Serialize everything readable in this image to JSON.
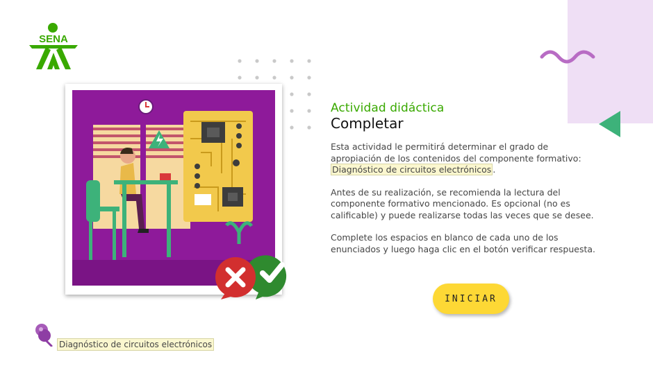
{
  "logo": {
    "text": "SENA",
    "color": "#39a900"
  },
  "intro": {
    "kicker": "Actividad didáctica",
    "title": "Completar",
    "p1_text": "Esta actividad le permitirá determinar el grado de apropiación de los contenidos del componente formativo: ",
    "p1_highlight": "Diagnóstico de circuitos electrónicos",
    "p1_end": ".",
    "p2": "Antes de su realización, se recomienda la lectura del componente formativo mencionado.  Es opcional (no es calificable) y puede realizarse todas las veces que se desee.",
    "p3": "Complete los espacios en blanco de cada uno de los enunciados y luego haga clic en el botón verificar respuesta."
  },
  "start_button": {
    "label": "INICIAR",
    "color": "#fdd835"
  },
  "footer": {
    "label": "Diagnóstico de circuitos electrónicos"
  },
  "colors": {
    "accent_green": "#39a900",
    "triangle": "#3db27a",
    "wave": "#b86cc4",
    "lilac": "#efdff5",
    "illustration_bg": "#8e1a9a"
  }
}
